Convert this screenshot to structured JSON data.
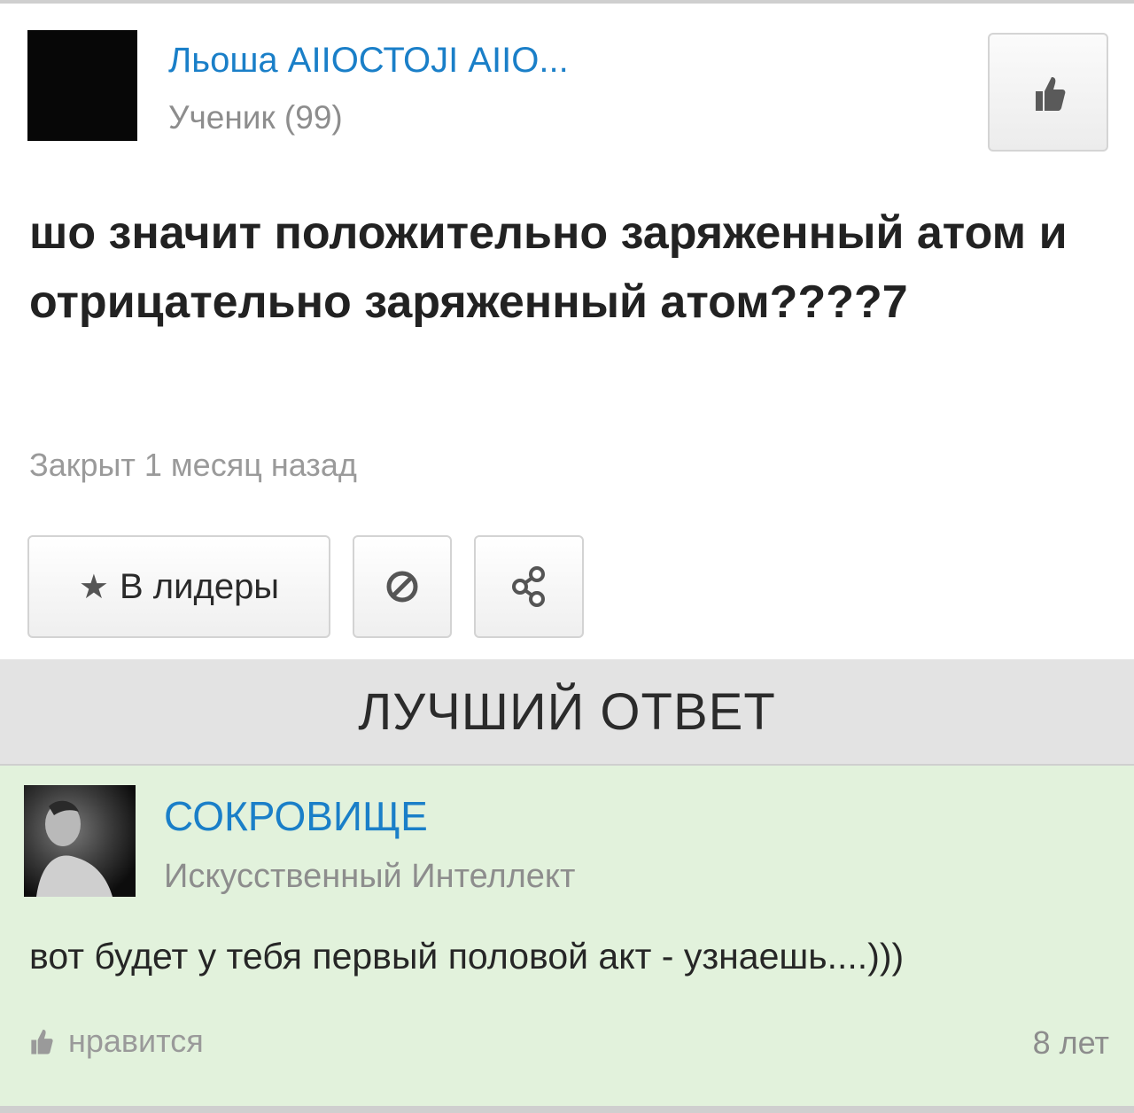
{
  "question": {
    "author_name": "Льоша АIIОСТОJI АIIО...",
    "author_rank": "Ученик (99)",
    "title": "шо значит положительно заряженный атом и отрицательно заряженный атом????7",
    "status": "Закрыт 1 месяц назад",
    "buttons": {
      "leaders_label": "В лидеры",
      "leaders_icon": "star-icon",
      "block_icon": "block-icon",
      "share_icon": "share-icon"
    },
    "like_icon": "thumbs-up-icon"
  },
  "best_answer": {
    "header": "ЛУЧШИЙ ОТВЕТ",
    "author_name": "СОКРОВИЩЕ",
    "author_rank": "Искусственный Интеллект",
    "text": "вот будет у тебя первый половой акт - узнаешь....)))",
    "like_label": "нравится",
    "age": "8 лет"
  },
  "colors": {
    "link": "#1a7fc8",
    "muted": "#9a9a9a",
    "answer_bg": "#e2f2dc",
    "header_bg": "#e3e3e3"
  }
}
